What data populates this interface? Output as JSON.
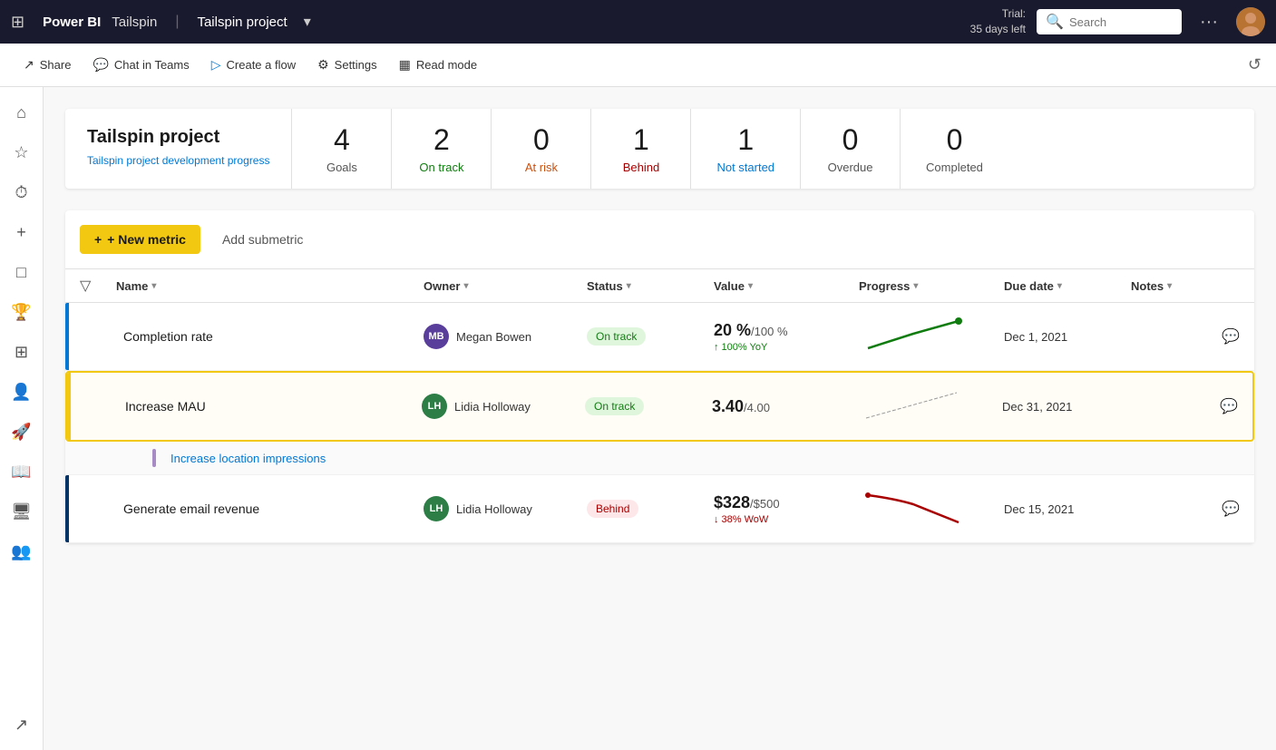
{
  "app": {
    "logo": "Power BI",
    "workspace": "Tailspin",
    "project_title": "Tailspin project",
    "trial_line1": "Trial:",
    "trial_line2": "35 days left",
    "search_placeholder": "Search",
    "more_icon": "···",
    "refresh_icon": "↺"
  },
  "toolbar": {
    "share": "Share",
    "chat": "Chat in Teams",
    "create_flow": "Create a flow",
    "settings": "Settings",
    "read_mode": "Read mode"
  },
  "sidebar": {
    "icons": [
      "⊞",
      "☆",
      "⏱",
      "+",
      "📦",
      "🏆",
      "⊞",
      "👤",
      "🚀",
      "📖",
      "💻",
      "👥",
      "↗"
    ]
  },
  "summary": {
    "title": "Tailspin project",
    "subtitle": "Tailspin project development progress",
    "stats": [
      {
        "number": "4",
        "label": "Goals",
        "class": ""
      },
      {
        "number": "2",
        "label": "On track",
        "class": "on-track"
      },
      {
        "number": "0",
        "label": "At risk",
        "class": "at-risk"
      },
      {
        "number": "1",
        "label": "Behind",
        "class": "behind"
      },
      {
        "number": "1",
        "label": "Not started",
        "class": "not-started"
      },
      {
        "number": "0",
        "label": "Overdue",
        "class": "overdue"
      },
      {
        "number": "0",
        "label": "Completed",
        "class": "completed"
      }
    ]
  },
  "actions": {
    "new_metric": "+ New metric",
    "add_submetric": "Add submetric"
  },
  "table": {
    "columns": [
      {
        "label": "Name",
        "key": "name"
      },
      {
        "label": "Owner",
        "key": "owner"
      },
      {
        "label": "Status",
        "key": "status"
      },
      {
        "label": "Value",
        "key": "value"
      },
      {
        "label": "Progress",
        "key": "progress"
      },
      {
        "label": "Due date",
        "key": "due_date"
      },
      {
        "label": "Notes",
        "key": "notes"
      }
    ],
    "rows": [
      {
        "id": "row1",
        "indicator": "blue",
        "name": "Completion rate",
        "owner_initials": "MB",
        "owner_name": "Megan Bowen",
        "owner_class": "avatar-mb",
        "status": "On track",
        "status_class": "status-on-track",
        "value_main": "20 %",
        "value_target": "/100 %",
        "value_change": "↑ 100% YoY",
        "value_change_class": "",
        "due_date": "Dec 1, 2021",
        "has_notes": true,
        "sparkline": "green_up",
        "selected": false
      },
      {
        "id": "row2",
        "indicator": "orange",
        "name": "Increase MAU",
        "owner_initials": "LH",
        "owner_name": "Lidia Holloway",
        "owner_class": "avatar-lh",
        "status": "On track",
        "status_class": "status-on-track",
        "value_main": "3.40",
        "value_target": "/4.00",
        "value_change": "",
        "value_change_class": "",
        "due_date": "Dec 31, 2021",
        "has_notes": true,
        "sparkline": "none",
        "selected": true,
        "has_submetric": true,
        "submetric_name": "Increase location impressions"
      },
      {
        "id": "row3",
        "indicator": "darkblue",
        "name": "Generate email revenue",
        "owner_initials": "LH",
        "owner_name": "Lidia Holloway",
        "owner_class": "avatar-lh",
        "status": "Behind",
        "status_class": "status-behind",
        "value_main": "$328",
        "value_target": "/$500",
        "value_change": "↓ 38% WoW",
        "value_change_class": "down",
        "due_date": "Dec 15, 2021",
        "has_notes": true,
        "sparkline": "red_down",
        "selected": false
      }
    ]
  }
}
